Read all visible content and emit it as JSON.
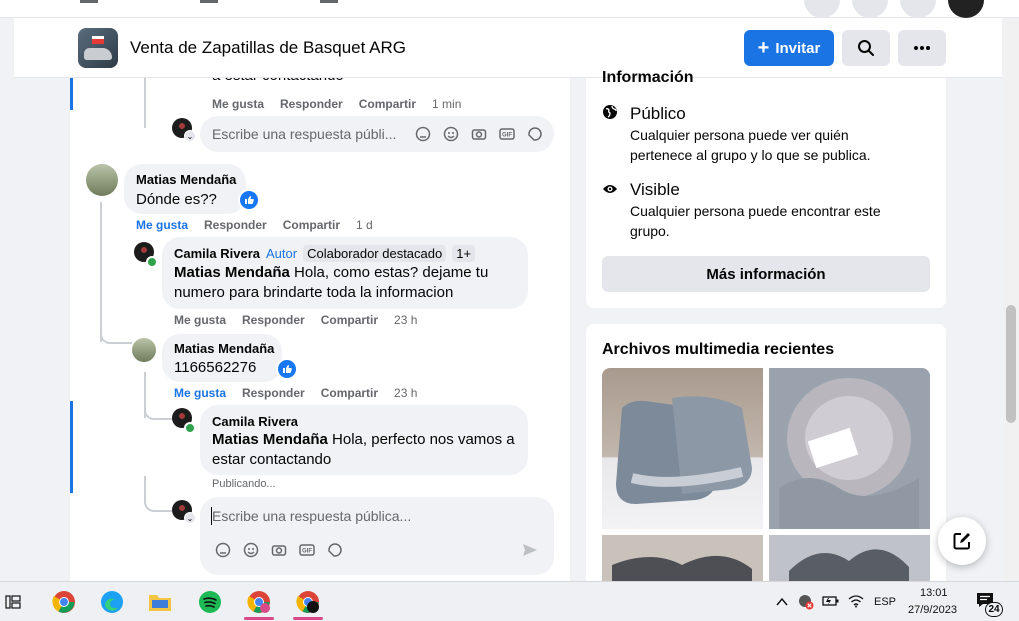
{
  "group": {
    "title": "Venta de Zapatillas de Basquet ARG",
    "invite_label": "Invitar"
  },
  "feed": {
    "prev_reply_tail": "a estar contactando",
    "prev_actions": {
      "like": "Me gusta",
      "reply": "Responder",
      "share": "Compartir",
      "time": "1 min"
    },
    "reply_placeholder": "Escribe una respuesta públi...",
    "comment_main": {
      "author": "Matias Mendaña",
      "text": "Dónde es??",
      "actions": {
        "like": "Me gusta",
        "reply": "Responder",
        "share": "Compartir",
        "time": "1 d"
      }
    },
    "reply_camila_1": {
      "author": "Camila Rivera",
      "tag_author": "Autor",
      "tag_badge": "Colaborador destacado",
      "tag_more": "1+",
      "mention": "Matias Mendaña",
      "text": " Hola, como estas? dejame tu numero para brindarte toda la informacion",
      "actions": {
        "like": "Me gusta",
        "reply": "Responder",
        "share": "Compartir",
        "time": "23 h"
      }
    },
    "reply_matias": {
      "author": "Matias Mendaña",
      "text": "1166562276",
      "actions": {
        "like": "Me gusta",
        "reply": "Responder",
        "share": "Compartir",
        "time": "23 h"
      }
    },
    "reply_camila_2": {
      "author": "Camila Rivera",
      "mention": "Matias Mendaña",
      "text": " Hola, perfecto nos vamos a estar contactando",
      "status": "Publicando..."
    },
    "reply_box_active_placeholder": "Escribe una respuesta pública..."
  },
  "info": {
    "title_partial": "Información",
    "public_head": "Público",
    "public_sub": "Cualquier persona puede ver quién pertenece al grupo y lo que se publica.",
    "visible_head": "Visible",
    "visible_sub": "Cualquier persona puede encontrar este grupo.",
    "more_btn": "Más información"
  },
  "media": {
    "title": "Archivos multimedia recientes"
  },
  "taskbar": {
    "lang": "ESP",
    "time": "13:01",
    "date": "27/9/2023",
    "notif_count": "24"
  },
  "colors": {
    "fb_blue": "#1b74e4",
    "online_green": "#31a24c"
  }
}
